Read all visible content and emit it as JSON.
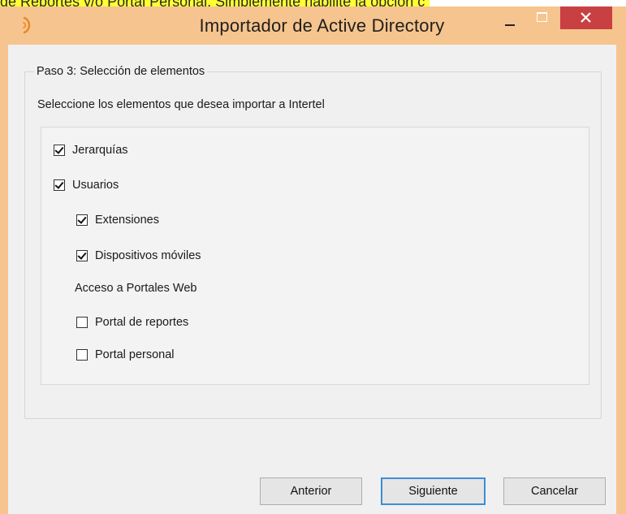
{
  "top_strip": {
    "text": "de Reportes y/o Portal Personal. Simplemente habilite la opción c"
  },
  "window": {
    "title": "Importador de Active Directory",
    "icon": "app-logo-icon",
    "border_color": "#f6c48e",
    "close_color": "#c94042"
  },
  "step": {
    "legend": "Paso 3: Selección de elementos",
    "instruction": "Seleccione los elementos que desea importar a Intertel"
  },
  "options": {
    "jerarquias": {
      "label": "Jerarquías",
      "checked": true
    },
    "usuarios": {
      "label": "Usuarios",
      "checked": true
    },
    "extensiones": {
      "label": "Extensiones",
      "checked": true
    },
    "dispositivos": {
      "label": "Dispositivos móviles",
      "checked": true
    },
    "portales_heading": "Acceso a Portales Web",
    "portal_reportes": {
      "label": "Portal de reportes",
      "checked": false
    },
    "portal_personal": {
      "label": "Portal personal",
      "checked": false
    }
  },
  "buttons": {
    "anterior": "Anterior",
    "siguiente": "Siguiente",
    "cancelar": "Cancelar"
  }
}
